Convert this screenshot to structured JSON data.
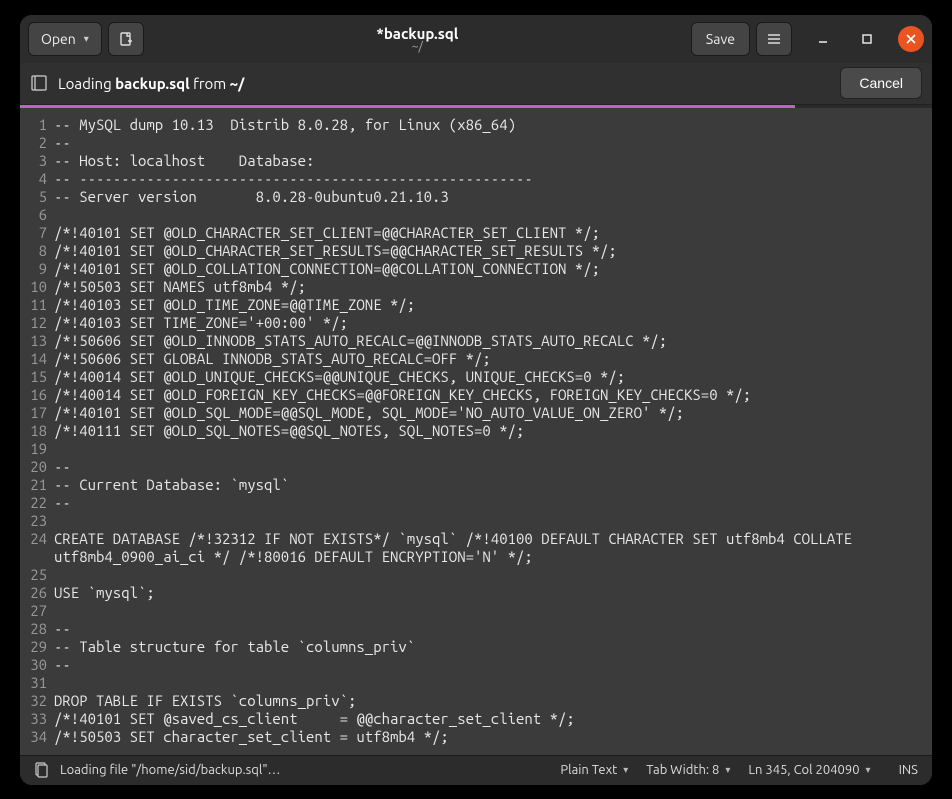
{
  "titlebar": {
    "open_label": "Open",
    "title": "*backup.sql",
    "subtitle": "~/",
    "save_label": "Save"
  },
  "infobar": {
    "prefix": "Loading ",
    "file": "backup.sql",
    "middle": " from ",
    "path": "~/",
    "cancel_label": "Cancel"
  },
  "progress_percent": 85,
  "code_lines": [
    "-- MySQL dump 10.13  Distrib 8.0.28, for Linux (x86_64)",
    "--",
    "-- Host: localhost    Database:",
    "-- ------------------------------------------------------",
    "-- Server version       8.0.28-0ubuntu0.21.10.3",
    "",
    "/*!40101 SET @OLD_CHARACTER_SET_CLIENT=@@CHARACTER_SET_CLIENT */;",
    "/*!40101 SET @OLD_CHARACTER_SET_RESULTS=@@CHARACTER_SET_RESULTS */;",
    "/*!40101 SET @OLD_COLLATION_CONNECTION=@@COLLATION_CONNECTION */;",
    "/*!50503 SET NAMES utf8mb4 */;",
    "/*!40103 SET @OLD_TIME_ZONE=@@TIME_ZONE */;",
    "/*!40103 SET TIME_ZONE='+00:00' */;",
    "/*!50606 SET @OLD_INNODB_STATS_AUTO_RECALC=@@INNODB_STATS_AUTO_RECALC */;",
    "/*!50606 SET GLOBAL INNODB_STATS_AUTO_RECALC=OFF */;",
    "/*!40014 SET @OLD_UNIQUE_CHECKS=@@UNIQUE_CHECKS, UNIQUE_CHECKS=0 */;",
    "/*!40014 SET @OLD_FOREIGN_KEY_CHECKS=@@FOREIGN_KEY_CHECKS, FOREIGN_KEY_CHECKS=0 */;",
    "/*!40101 SET @OLD_SQL_MODE=@@SQL_MODE, SQL_MODE='NO_AUTO_VALUE_ON_ZERO' */;",
    "/*!40111 SET @OLD_SQL_NOTES=@@SQL_NOTES, SQL_NOTES=0 */;",
    "",
    "--",
    "-- Current Database: `mysql`",
    "--",
    "",
    "CREATE DATABASE /*!32312 IF NOT EXISTS*/ `mysql` /*!40100 DEFAULT CHARACTER SET utf8mb4 COLLATE utf8mb4_0900_ai_ci */ /*!80016 DEFAULT ENCRYPTION='N' */;",
    "",
    "USE `mysql`;",
    "",
    "--",
    "-- Table structure for table `columns_priv`",
    "--",
    "",
    "DROP TABLE IF EXISTS `columns_priv`;",
    "/*!40101 SET @saved_cs_client     = @@character_set_client */;",
    "/*!50503 SET character_set_client = utf8mb4 */;"
  ],
  "statusbar": {
    "loading_text": "Loading file \"/home/sid/backup.sql\"…",
    "syntax": "Plain Text",
    "tab_width": "Tab Width: 8",
    "position": "Ln 345, Col 204090",
    "mode": "INS"
  }
}
